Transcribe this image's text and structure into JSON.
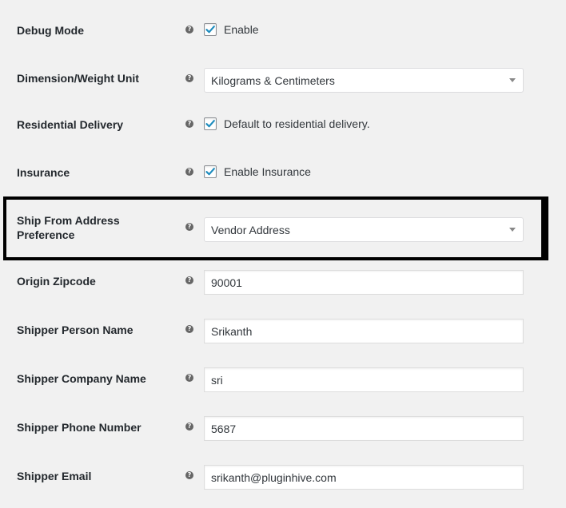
{
  "help_glyph": "?",
  "rows": {
    "debug_mode": {
      "label": "Debug Mode",
      "checkbox_label": "Enable",
      "checked": true
    },
    "dimension_weight_unit": {
      "label": "Dimension/Weight Unit",
      "selected": "Kilograms & Centimeters"
    },
    "residential_delivery": {
      "label": "Residential Delivery",
      "checkbox_label": "Default to residential delivery.",
      "checked": true
    },
    "insurance": {
      "label": "Insurance",
      "checkbox_label": "Enable Insurance",
      "checked": true
    },
    "ship_from": {
      "label_line1": "Ship From Address",
      "label_line2": "Preference",
      "selected": "Vendor Address"
    },
    "origin_zipcode": {
      "label": "Origin Zipcode",
      "value": "90001"
    },
    "shipper_person_name": {
      "label": "Shipper Person Name",
      "value": "Srikanth"
    },
    "shipper_company_name": {
      "label": "Shipper Company Name",
      "value": "sri"
    },
    "shipper_phone_number": {
      "label": "Shipper Phone Number",
      "value": "5687"
    },
    "shipper_email": {
      "label": "Shipper Email",
      "value": "srikanth@pluginhive.com"
    }
  },
  "colors": {
    "check_mark": "#1e8cbe",
    "highlight_border": "#000000",
    "background": "#f1f1f1"
  }
}
